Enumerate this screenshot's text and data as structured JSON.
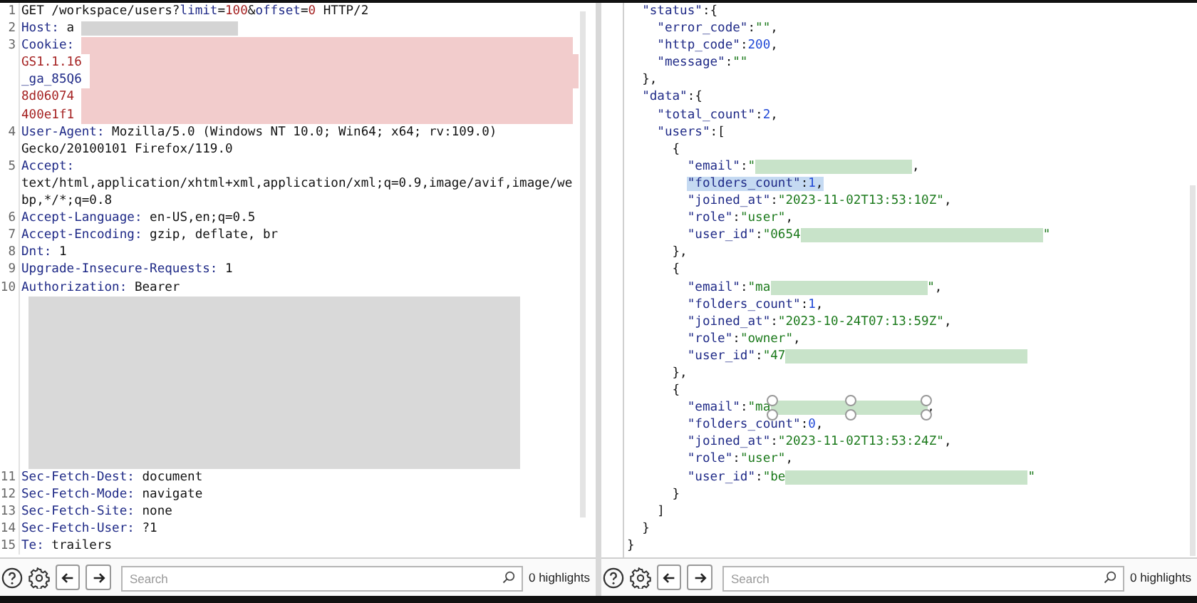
{
  "panes": [
    {
      "kind": "request",
      "rows": [
        {
          "number": "1",
          "parts": [
            {
              "kind": "plain",
              "text": "GET /workspace/users?"
            },
            {
              "kind": "name",
              "text": "limit"
            },
            {
              "kind": "plain",
              "text": "="
            },
            {
              "kind": "red",
              "text": "100"
            },
            {
              "kind": "plain",
              "text": "&"
            },
            {
              "kind": "name",
              "text": "offset"
            },
            {
              "kind": "plain",
              "text": "="
            },
            {
              "kind": "red",
              "text": "0"
            },
            {
              "kind": "plain",
              "text": " HTTP/2"
            }
          ]
        },
        {
          "number": "2",
          "parts": [
            {
              "kind": "name",
              "text": "Host:"
            },
            {
              "kind": "plain",
              "text": " a"
            },
            {
              "kind": "mask-short",
              "color": "#d4d4d4"
            }
          ]
        },
        {
          "number": "3",
          "parts": [
            {
              "kind": "name",
              "text": "Cookie:"
            },
            {
              "kind": "mask-fill",
              "color": "#f2cccc"
            }
          ]
        },
        {
          "parts": [
            {
              "kind": "red",
              "text": "GS1.1.16"
            },
            {
              "kind": "mask-fill",
              "color": "#f2cccc"
            }
          ]
        },
        {
          "parts": [
            {
              "kind": "name",
              "text": "_ga_85Q6"
            },
            {
              "kind": "mask-fill",
              "color": "#f2cccc"
            }
          ]
        },
        {
          "parts": [
            {
              "kind": "red",
              "text": "8d06074"
            },
            {
              "kind": "mask-fill",
              "color": "#f2cccc"
            }
          ]
        },
        {
          "parts": [
            {
              "kind": "red",
              "text": "400e1f1"
            },
            {
              "kind": "mask-fill",
              "color": "#f2cccc"
            }
          ]
        },
        {
          "number": "4",
          "parts": [
            {
              "kind": "name",
              "text": "User-Agent:"
            },
            {
              "kind": "plain",
              "text": " Mozilla/5.0 (Windows NT 10.0; Win64; x64; rv:109.0)"
            }
          ]
        },
        {
          "parts": [
            {
              "kind": "plain",
              "text": "Gecko/20100101 Firefox/119.0"
            }
          ]
        },
        {
          "number": "5",
          "parts": [
            {
              "kind": "name",
              "text": "Accept:"
            }
          ]
        },
        {
          "parts": [
            {
              "kind": "plain",
              "text": "text/html,application/xhtml+xml,application/xml;q=0.9,image/avif,image/we"
            }
          ]
        },
        {
          "parts": [
            {
              "kind": "plain",
              "text": "bp,*/*;q=0.8"
            }
          ]
        },
        {
          "number": "6",
          "parts": [
            {
              "kind": "name",
              "text": "Accept-Language:"
            },
            {
              "kind": "plain",
              "text": " en-US,en;q=0.5"
            }
          ]
        },
        {
          "number": "7",
          "parts": [
            {
              "kind": "name",
              "text": "Accept-Encoding:"
            },
            {
              "kind": "plain",
              "text": " gzip, deflate, br"
            }
          ]
        },
        {
          "number": "8",
          "parts": [
            {
              "kind": "name",
              "text": "Dnt:"
            },
            {
              "kind": "plain",
              "text": " 1"
            }
          ]
        },
        {
          "number": "9",
          "parts": [
            {
              "kind": "name",
              "text": "Upgrade-Insecure-Requests:"
            },
            {
              "kind": "plain",
              "text": " 1"
            }
          ]
        },
        {
          "number": "10",
          "parts": [
            {
              "kind": "name",
              "text": "Authorization:"
            },
            {
              "kind": "plain",
              "text": " Bearer"
            }
          ]
        },
        {
          "parts": [
            {
              "kind": "mask-fill",
              "color": "#d9d9d9"
            }
          ]
        },
        {
          "parts": [
            {
              "kind": "mask-fill",
              "color": "#d9d9d9"
            }
          ]
        },
        {
          "parts": [
            {
              "kind": "mask-fill",
              "color": "#d9d9d9"
            }
          ]
        },
        {
          "parts": [
            {
              "kind": "mask-fill",
              "color": "#d9d9d9"
            }
          ]
        },
        {
          "parts": [
            {
              "kind": "mask-fill",
              "color": "#d9d9d9"
            }
          ]
        },
        {
          "parts": [
            {
              "kind": "mask-fill",
              "color": "#d9d9d9"
            }
          ]
        },
        {
          "parts": [
            {
              "kind": "mask-fill",
              "color": "#d9d9d9"
            }
          ]
        },
        {
          "parts": [
            {
              "kind": "mask-fill",
              "color": "#d9d9d9"
            }
          ]
        },
        {
          "parts": [
            {
              "kind": "mask-fill",
              "color": "#d9d9d9"
            }
          ]
        },
        {
          "parts": [
            {
              "kind": "mask-fill",
              "color": "#d9d9d9"
            }
          ]
        },
        {
          "number": "11",
          "parts": [
            {
              "kind": "name",
              "text": "Sec-Fetch-Dest:"
            },
            {
              "kind": "plain",
              "text": " document"
            }
          ]
        },
        {
          "number": "12",
          "parts": [
            {
              "kind": "name",
              "text": "Sec-Fetch-Mode:"
            },
            {
              "kind": "plain",
              "text": " navigate"
            }
          ]
        },
        {
          "number": "13",
          "parts": [
            {
              "kind": "name",
              "text": "Sec-Fetch-Site:"
            },
            {
              "kind": "plain",
              "text": " none"
            }
          ]
        },
        {
          "number": "14",
          "parts": [
            {
              "kind": "name",
              "text": "Sec-Fetch-User:"
            },
            {
              "kind": "plain",
              "text": " ?1"
            }
          ]
        },
        {
          "number": "15",
          "parts": [
            {
              "kind": "name",
              "text": "Te:"
            },
            {
              "kind": "plain",
              "text": " trailers"
            }
          ]
        }
      ],
      "toolbar": {
        "search": {
          "placeholder": "Search"
        },
        "highlights": "0 highlights"
      }
    },
    {
      "kind": "response",
      "rows": [
        {
          "children": [
            {
              "parts": [
                {
                  "kind": "key",
                  "text": "\"status\""
                },
                {
                  "kind": "punct",
                  "text": ":{"
                }
              ],
              "children": [
                {
                  "parts": [
                    {
                      "kind": "key",
                      "text": "\"error_code\""
                    },
                    {
                      "kind": "punct",
                      "text": ":"
                    },
                    {
                      "kind": "str",
                      "text": "\"\""
                    },
                    {
                      "kind": "punct",
                      "text": ","
                    }
                  ]
                },
                {
                  "parts": [
                    {
                      "kind": "key",
                      "text": "\"http_code\""
                    },
                    {
                      "kind": "punct",
                      "text": ":"
                    },
                    {
                      "kind": "num",
                      "text": "200"
                    },
                    {
                      "kind": "punct",
                      "text": ","
                    }
                  ]
                },
                {
                  "parts": [
                    {
                      "kind": "key",
                      "text": "\"message\""
                    },
                    {
                      "kind": "punct",
                      "text": ":"
                    },
                    {
                      "kind": "str",
                      "text": "\"\""
                    }
                  ]
                }
              ]
            },
            {
              "parts": [
                {
                  "kind": "punct",
                  "text": "},"
                }
              ]
            },
            {
              "parts": [
                {
                  "kind": "key",
                  "text": "\"data\""
                },
                {
                  "kind": "punct",
                  "text": ":{"
                }
              ],
              "children": [
                {
                  "parts": [
                    {
                      "kind": "key",
                      "text": "\"total_count\""
                    },
                    {
                      "kind": "punct",
                      "text": ":"
                    },
                    {
                      "kind": "num",
                      "text": "2"
                    },
                    {
                      "kind": "punct",
                      "text": ","
                    }
                  ]
                },
                {
                  "parts": [
                    {
                      "kind": "key",
                      "text": "\"users\""
                    },
                    {
                      "kind": "punct",
                      "text": ":["
                    }
                  ],
                  "children": [
                    {
                      "parts": [
                        {
                          "kind": "punct",
                          "text": "{"
                        }
                      ],
                      "children": [
                        {
                          "parts": [
                            {
                              "kind": "key",
                              "text": "\"email\""
                            },
                            {
                              "kind": "punct",
                              "text": ":"
                            },
                            {
                              "kind": "str",
                              "text": "\""
                            },
                            {
                              "kind": "mask-short",
                              "color": "#c8e3c9"
                            },
                            {
                              "kind": "punct",
                              "text": ","
                            }
                          ]
                        },
                        {
                          "parts": [
                            {
                              "kind": "key",
                              "text": "\"folders_count\"",
                              "highlighted": true
                            },
                            {
                              "kind": "punct",
                              "text": ":",
                              "highlighted": true
                            },
                            {
                              "kind": "num",
                              "text": "1",
                              "highlighted": true
                            },
                            {
                              "kind": "punct",
                              "text": ",",
                              "highlighted": true
                            }
                          ]
                        },
                        {
                          "parts": [
                            {
                              "kind": "key",
                              "text": "\"joined_at\""
                            },
                            {
                              "kind": "punct",
                              "text": ":"
                            },
                            {
                              "kind": "str",
                              "text": "\"2023-11-02T13:53:10Z\""
                            },
                            {
                              "kind": "punct",
                              "text": ","
                            }
                          ]
                        },
                        {
                          "parts": [
                            {
                              "kind": "key",
                              "text": "\"role\""
                            },
                            {
                              "kind": "punct",
                              "text": ":"
                            },
                            {
                              "kind": "str",
                              "text": "\"user\""
                            },
                            {
                              "kind": "punct",
                              "text": ","
                            }
                          ]
                        },
                        {
                          "parts": [
                            {
                              "kind": "key",
                              "text": "\"user_id\""
                            },
                            {
                              "kind": "punct",
                              "text": ":"
                            },
                            {
                              "kind": "str",
                              "text": "\"0654"
                            },
                            {
                              "kind": "mask-long",
                              "color": "#c8e3c9"
                            },
                            {
                              "kind": "str",
                              "text": "\""
                            }
                          ]
                        }
                      ]
                    },
                    {
                      "parts": [
                        {
                          "kind": "punct",
                          "text": "},"
                        }
                      ]
                    },
                    {
                      "parts": [
                        {
                          "kind": "punct",
                          "text": "{"
                        }
                      ],
                      "children": [
                        {
                          "parts": [
                            {
                              "kind": "key",
                              "text": "\"email\""
                            },
                            {
                              "kind": "punct",
                              "text": ":"
                            },
                            {
                              "kind": "str",
                              "text": "\"ma"
                            },
                            {
                              "kind": "mask-short",
                              "color": "#c8e3c9"
                            },
                            {
                              "kind": "str",
                              "text": "\""
                            },
                            {
                              "kind": "punct",
                              "text": ","
                            }
                          ]
                        },
                        {
                          "parts": [
                            {
                              "kind": "key",
                              "text": "\"folders_count\""
                            },
                            {
                              "kind": "punct",
                              "text": ":"
                            },
                            {
                              "kind": "num",
                              "text": "1"
                            },
                            {
                              "kind": "punct",
                              "text": ","
                            }
                          ]
                        },
                        {
                          "parts": [
                            {
                              "kind": "key",
                              "text": "\"joined_at\""
                            },
                            {
                              "kind": "punct",
                              "text": ":"
                            },
                            {
                              "kind": "str",
                              "text": "\"2023-10-24T07:13:59Z\""
                            },
                            {
                              "kind": "punct",
                              "text": ","
                            }
                          ]
                        },
                        {
                          "parts": [
                            {
                              "kind": "key",
                              "text": "\"role\""
                            },
                            {
                              "kind": "punct",
                              "text": ":"
                            },
                            {
                              "kind": "str",
                              "text": "\"owner\""
                            },
                            {
                              "kind": "punct",
                              "text": ","
                            }
                          ]
                        },
                        {
                          "parts": [
                            {
                              "kind": "key",
                              "text": "\"user_id\""
                            },
                            {
                              "kind": "punct",
                              "text": ":"
                            },
                            {
                              "kind": "str",
                              "text": "\"47"
                            },
                            {
                              "kind": "mask-long",
                              "color": "#c8e3c9"
                            }
                          ]
                        }
                      ]
                    },
                    {
                      "parts": [
                        {
                          "kind": "punct",
                          "text": "},"
                        }
                      ]
                    },
                    {
                      "parts": [
                        {
                          "kind": "punct",
                          "text": "{"
                        }
                      ],
                      "children": [
                        {
                          "parts": [
                            {
                              "kind": "key",
                              "text": "\"email\""
                            },
                            {
                              "kind": "punct",
                              "text": ":"
                            },
                            {
                              "kind": "str",
                              "text": "\"ma"
                            },
                            {
                              "kind": "mask-short",
                              "color": "#c8e3c9",
                              "handles": true
                            },
                            {
                              "kind": "punct",
                              "text": ","
                            }
                          ]
                        },
                        {
                          "parts": [
                            {
                              "kind": "key",
                              "text": "\"folders_count\""
                            },
                            {
                              "kind": "punct",
                              "text": ":"
                            },
                            {
                              "kind": "num",
                              "text": "0"
                            },
                            {
                              "kind": "punct",
                              "text": ","
                            }
                          ]
                        },
                        {
                          "parts": [
                            {
                              "kind": "key",
                              "text": "\"joined_at\""
                            },
                            {
                              "kind": "punct",
                              "text": ":"
                            },
                            {
                              "kind": "str",
                              "text": "\"2023-11-02T13:53:24Z\""
                            },
                            {
                              "kind": "punct",
                              "text": ","
                            }
                          ]
                        },
                        {
                          "parts": [
                            {
                              "kind": "key",
                              "text": "\"role\""
                            },
                            {
                              "kind": "punct",
                              "text": ":"
                            },
                            {
                              "kind": "str",
                              "text": "\"user\""
                            },
                            {
                              "kind": "punct",
                              "text": ","
                            }
                          ]
                        },
                        {
                          "parts": [
                            {
                              "kind": "key",
                              "text": "\"user_id\""
                            },
                            {
                              "kind": "punct",
                              "text": ":"
                            },
                            {
                              "kind": "str",
                              "text": "\"be"
                            },
                            {
                              "kind": "mask-long",
                              "color": "#c8e3c9"
                            },
                            {
                              "kind": "str",
                              "text": "\""
                            }
                          ]
                        }
                      ]
                    },
                    {
                      "parts": [
                        {
                          "kind": "punct",
                          "text": "}"
                        }
                      ]
                    }
                  ]
                },
                {
                  "parts": [
                    {
                      "kind": "punct",
                      "text": "]"
                    }
                  ]
                }
              ]
            },
            {
              "parts": [
                {
                  "kind": "punct",
                  "text": "}"
                }
              ]
            }
          ]
        },
        {
          "parts": [
            {
              "kind": "punct",
              "text": "}"
            }
          ]
        }
      ],
      "toolbar": {
        "search": {
          "placeholder": "Search"
        },
        "highlights": "0 highlights"
      }
    }
  ]
}
